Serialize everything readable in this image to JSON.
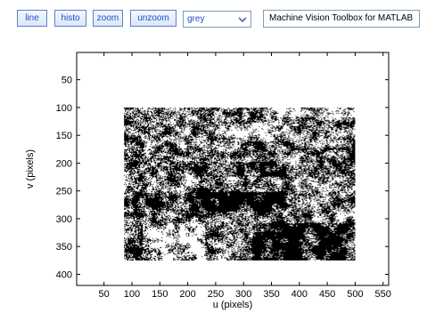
{
  "toolbar": {
    "buttons": [
      {
        "label": "line"
      },
      {
        "label": "histo"
      },
      {
        "label": "zoom"
      },
      {
        "label": "unzoom"
      }
    ],
    "colormap": {
      "selected": "grey"
    },
    "title": "Machine Vision Toolbox for MATLAB",
    "accent_color": "#1a4fc4"
  },
  "axes": {
    "xlabel": "u (pixels)",
    "ylabel": "v (pixels)",
    "xticks": [
      50,
      100,
      150,
      200,
      250,
      300,
      350,
      400,
      450,
      500,
      550
    ],
    "yticks": [
      50,
      100,
      150,
      200,
      250,
      300,
      350,
      400
    ],
    "xlim": [
      1,
      560
    ],
    "ylim": [
      1,
      420
    ],
    "image_extent": {
      "u": [
        86,
        500
      ],
      "v": [
        100,
        375
      ]
    },
    "image_description": "binary thresholded image",
    "colors": {
      "foreground": "#ffffff",
      "background": "#000000"
    }
  }
}
